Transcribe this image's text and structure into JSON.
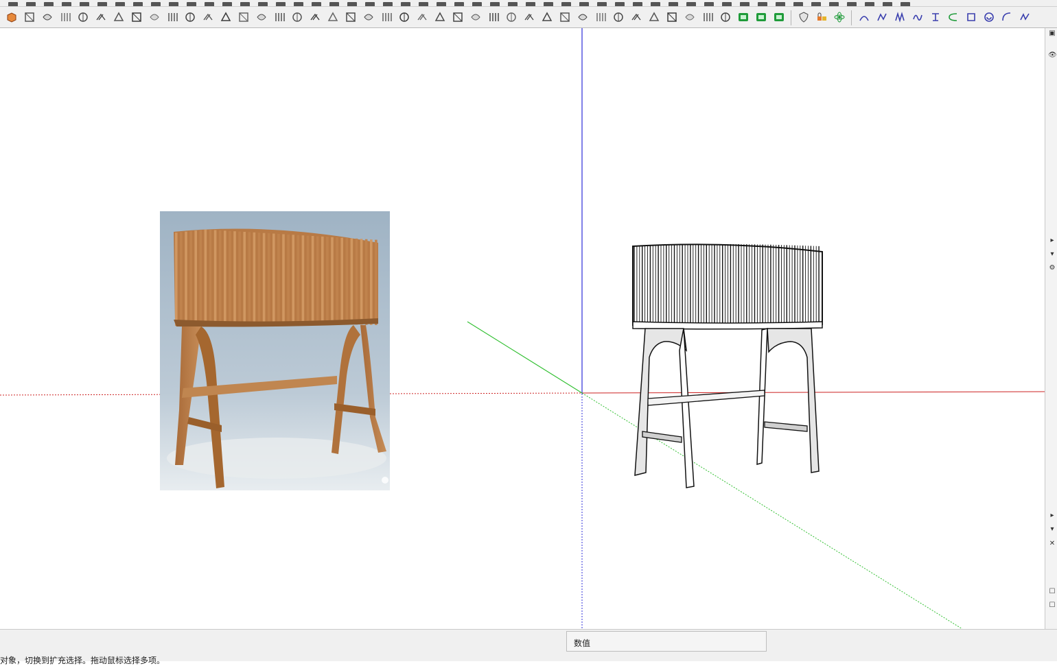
{
  "toolbar": {
    "top_row_icons": [
      "paint-bucket",
      "eraser",
      "pencil",
      "line",
      "arc",
      "rectangle",
      "circle",
      "polygon",
      "push-pull",
      "follow-me",
      "move",
      "rotate",
      "scale",
      "offset",
      "tape-measure",
      "dimension",
      "protractor",
      "text",
      "axes",
      "3d-text",
      "orbit",
      "pan",
      "zoom",
      "zoom-window",
      "zoom-extents",
      "previous-view",
      "next-view",
      "camera",
      "walk",
      "look-around",
      "section-plane",
      "shaded",
      "wireframe",
      "hidden-line",
      "monochrome",
      "x-ray",
      "back-edges",
      "shadows",
      "fog",
      "styles",
      "layers",
      "materials",
      "components",
      "outliner",
      "scenes",
      "warehouse",
      "extension-store",
      "sandbox",
      "solar",
      "export",
      "print"
    ],
    "main_groups": [
      {
        "name": "plugin-tools-a",
        "icons": [
          "box-red",
          "cube-3d",
          "stack-3d",
          "scissor-line",
          "spiral",
          "offset-curve",
          "curve-loop",
          "bend-arrow",
          "sphere-mesh",
          "shear",
          "knot",
          "curve-bend",
          "corner-tool",
          "angle-tool",
          "slope-tool",
          "curve-tool",
          "grid-box",
          "cone",
          "pin-tool",
          "column-array",
          "barrel",
          "shell",
          "arc-mesh",
          "bevel",
          "fold",
          "stair",
          "split-tool",
          "drop-tool",
          "weave",
          "fork",
          "plane-stack",
          "ribbon",
          "sweep",
          "stripe",
          "hatch",
          "pattern",
          "layers-stack",
          "spin",
          "shingle",
          "gem",
          "arrow-group",
          "green-box",
          "green-cube",
          "green-circle"
        ]
      },
      {
        "name": "plugin-tools-b",
        "icons": [
          "shield",
          "lock-pair",
          "atom"
        ]
      },
      {
        "name": "curve-tools",
        "icons": [
          "bezier-arc",
          "freehand",
          "spring",
          "wave",
          "split",
          "curve-c",
          "square",
          "spiral-circle",
          "arc-open",
          "zigzag"
        ]
      }
    ]
  },
  "viewport": {
    "axes": {
      "blue": "#2b2bd8",
      "red": "#cc2020",
      "green": "#2fbf2f"
    },
    "reference_image": {
      "subject": "wooden slatted cabinet on legs",
      "wood_color": "#b87a45",
      "background_color": "#b7c6d3"
    },
    "model": {
      "subject": "slatted cabinet line drawing",
      "line_color": "#111111",
      "fill_color": "#ffffff",
      "shade_color": "#d4d4d4"
    }
  },
  "right_tray": {
    "icons": [
      "tray-tag-icon",
      "eye-icon",
      "expand-right-icon",
      "collapse-down-icon",
      "info-icon",
      "expand-right-icon-2",
      "collapse-down-icon-2",
      "close-icon",
      "checkbox-icon",
      "checkbox-icon-2"
    ]
  },
  "status_bar": {
    "hint": "对象，切换到扩充选择。拖动鼠标选择多项。",
    "measure_label": "数值",
    "measure_value": ""
  }
}
